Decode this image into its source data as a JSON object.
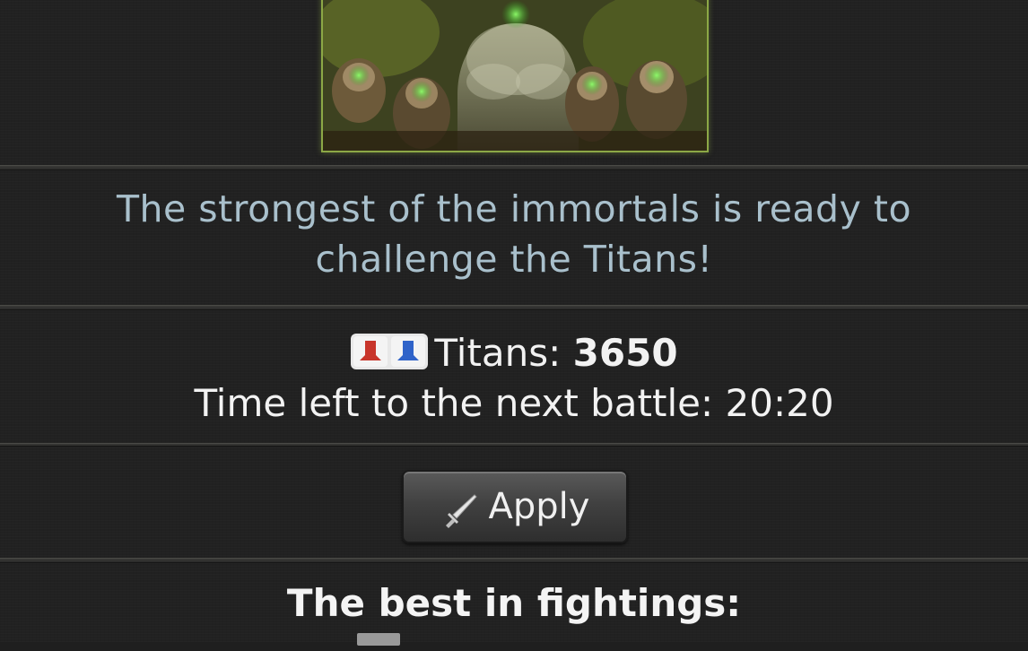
{
  "battle": {
    "tagline_line1": "The strongest of the immortals is ready to",
    "tagline_line2": "challenge the Titans!",
    "titans_label": "Titans:",
    "titans_count": "3650",
    "timer_label": "Time left to the next battle:",
    "timer_value": "20:20",
    "apply_label": "Apply",
    "best_heading": "The best in fightings:"
  },
  "colors": {
    "tagline": "#a9c0cc",
    "frame_border": "#8ca846",
    "leader_name": "#d7a23a",
    "titan_red": "#c8352b",
    "titan_blue": "#2f63c9"
  },
  "icons": {
    "titans": "red-blue-titan-icon",
    "apply": "sword-icon"
  }
}
